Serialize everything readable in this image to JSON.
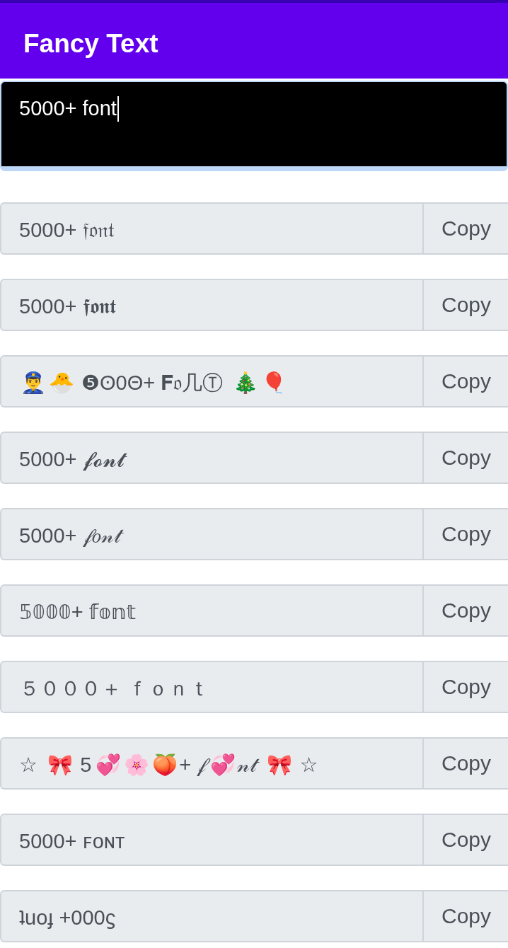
{
  "app_bar": {
    "title": "Fancy Text"
  },
  "input": {
    "value": "5000+ font",
    "focused": true
  },
  "results": [
    {
      "text": "5000+ 𝔣𝔬𝔫𝔱",
      "button": "Copy"
    },
    {
      "text": "5000+ 𝖋𝖔𝖓𝖙",
      "button": "Copy"
    },
    {
      "text": "👮‍♂️🐣 ❺ʘ0Θ+ 𝐅𝔬几Ⓣ 🎄🎈",
      "button": "Copy"
    },
    {
      "text": "5000+ 𝓯𝓸𝓷𝓽",
      "button": "Copy"
    },
    {
      "text": "5000+ 𝒻𝑜𝓃𝓉",
      "button": "Copy"
    },
    {
      "text": "𝟝𝟘𝟘𝟘+ 𝕗𝕠𝕟𝕥",
      "button": "Copy"
    },
    {
      "text": "５０００＋ ｆｏｎｔ",
      "button": "Copy"
    },
    {
      "text": "☆ 🎀 5💞🌸🍑+ 𝒻💞𝓃𝓉 🎀 ☆",
      "button": "Copy"
    },
    {
      "text": "5000+ ꜰᴏɴᴛ",
      "button": "Copy"
    },
    {
      "text": "ʇuoɟ +000ϛ",
      "button": "Copy"
    }
  ]
}
